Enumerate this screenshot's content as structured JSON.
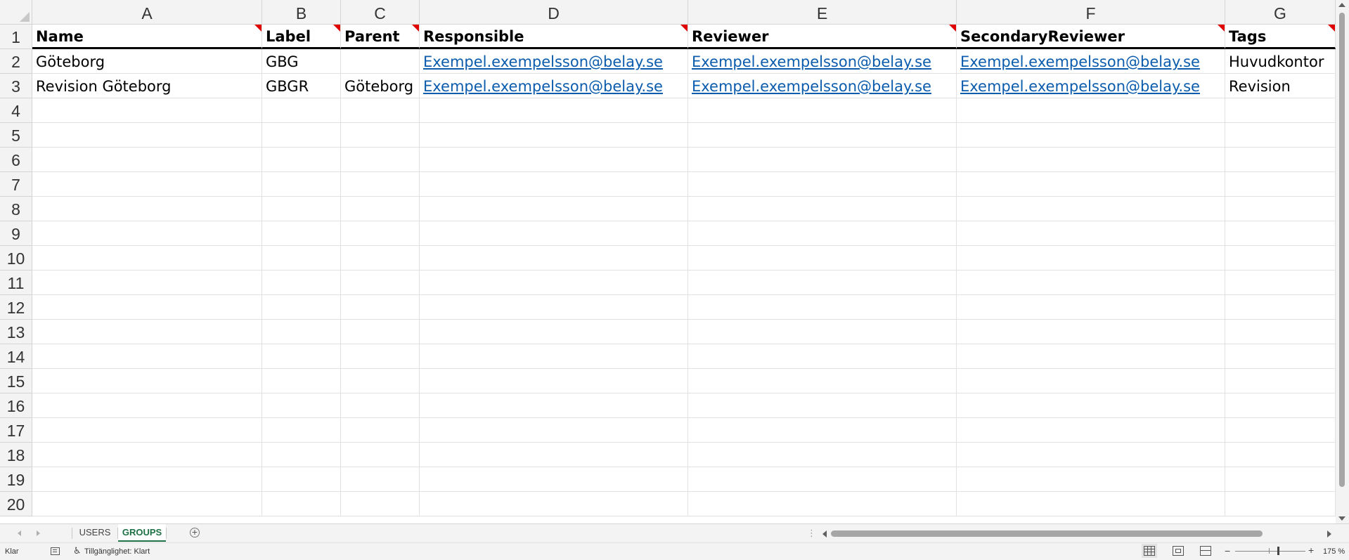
{
  "columns": [
    "A",
    "B",
    "C",
    "D",
    "E",
    "F",
    "G"
  ],
  "rows": [
    "1",
    "2",
    "3",
    "4",
    "5",
    "6",
    "7",
    "8",
    "9",
    "10",
    "11",
    "12",
    "13",
    "14",
    "15",
    "16",
    "17",
    "18",
    "19",
    "20"
  ],
  "headers": [
    "Name",
    "Label",
    "Parent",
    "Responsible",
    "Reviewer",
    "SecondaryReviewer",
    "Tags"
  ],
  "data_rows": [
    [
      "Göteborg",
      "GBG",
      "",
      "Exempel.exempelsson@belay.se",
      "Exempel.exempelsson@belay.se",
      "Exempel.exempelsson@belay.se",
      "Huvudkontor"
    ],
    [
      "Revision Göteborg",
      "GBGR",
      "Göteborg",
      "Exempel.exempelsson@belay.se",
      "Exempel.exempelsson@belay.se",
      "Exempel.exempelsson@belay.se",
      "Revision"
    ]
  ],
  "link_columns": [
    3,
    4,
    5
  ],
  "comment_columns": [
    0,
    1,
    2,
    3,
    4,
    5,
    6
  ],
  "sheet_tabs": [
    {
      "label": "USERS",
      "active": false
    },
    {
      "label": "GROUPS",
      "active": true
    }
  ],
  "add_sheet_symbol": "+",
  "status": {
    "ready": "Klar",
    "accessibility": "Tillgänglighet: Klart",
    "zoom_minus": "−",
    "zoom_plus": "+",
    "zoom": "175 %"
  },
  "colors": {
    "link": "#0b5cad",
    "active_tab": "#1e7145",
    "comment_marker": "#e00000"
  }
}
